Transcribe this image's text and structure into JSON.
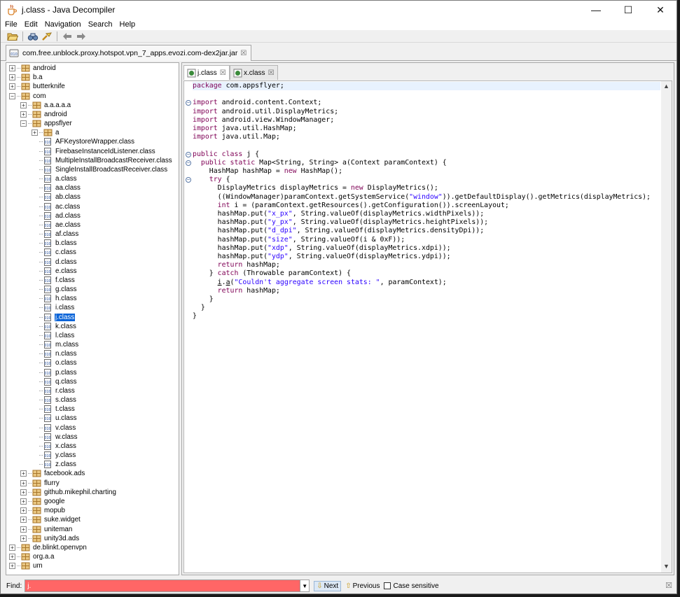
{
  "window": {
    "title": "j.class - Java Decompiler",
    "minimize": "—",
    "maximize": "☐",
    "close": "✕"
  },
  "menu": [
    "File",
    "Edit",
    "Navigation",
    "Search",
    "Help"
  ],
  "file_tab": {
    "label": "com.free.unblock.proxy.hotspot.vpn_7_apps.evozi.com-dex2jar.jar",
    "close": "☒"
  },
  "tree": [
    {
      "label": "android",
      "kind": "pkg",
      "level": 0,
      "expanded": false
    },
    {
      "label": "b.a",
      "kind": "pkg",
      "level": 0,
      "expanded": false
    },
    {
      "label": "butterknife",
      "kind": "pkg",
      "level": 0,
      "expanded": false
    },
    {
      "label": "com",
      "kind": "pkg",
      "level": 0,
      "expanded": true
    },
    {
      "label": "a.a.a.a.a",
      "kind": "pkg",
      "level": 1,
      "expanded": false
    },
    {
      "label": "android",
      "kind": "pkg",
      "level": 1,
      "expanded": false
    },
    {
      "label": "appsflyer",
      "kind": "pkg",
      "level": 1,
      "expanded": true
    },
    {
      "label": "a",
      "kind": "pkg",
      "level": 2,
      "expanded": false
    },
    {
      "label": "AFKeystoreWrapper.class",
      "kind": "class",
      "level": 2
    },
    {
      "label": "FirebaseInstanceIdListener.class",
      "kind": "class",
      "level": 2
    },
    {
      "label": "MultipleInstallBroadcastReceiver.class",
      "kind": "class",
      "level": 2
    },
    {
      "label": "SingleInstallBroadcastReceiver.class",
      "kind": "class",
      "level": 2
    },
    {
      "label": "a.class",
      "kind": "class",
      "level": 2
    },
    {
      "label": "aa.class",
      "kind": "class",
      "level": 2
    },
    {
      "label": "ab.class",
      "kind": "class",
      "level": 2
    },
    {
      "label": "ac.class",
      "kind": "class",
      "level": 2
    },
    {
      "label": "ad.class",
      "kind": "class",
      "level": 2
    },
    {
      "label": "ae.class",
      "kind": "class",
      "level": 2
    },
    {
      "label": "af.class",
      "kind": "class",
      "level": 2
    },
    {
      "label": "b.class",
      "kind": "class",
      "level": 2
    },
    {
      "label": "c.class",
      "kind": "class",
      "level": 2
    },
    {
      "label": "d.class",
      "kind": "class",
      "level": 2
    },
    {
      "label": "e.class",
      "kind": "class",
      "level": 2
    },
    {
      "label": "f.class",
      "kind": "class",
      "level": 2
    },
    {
      "label": "g.class",
      "kind": "class",
      "level": 2
    },
    {
      "label": "h.class",
      "kind": "class",
      "level": 2
    },
    {
      "label": "i.class",
      "kind": "class",
      "level": 2
    },
    {
      "label": "j.class",
      "kind": "class",
      "level": 2,
      "selected": true
    },
    {
      "label": "k.class",
      "kind": "class",
      "level": 2
    },
    {
      "label": "l.class",
      "kind": "class",
      "level": 2
    },
    {
      "label": "m.class",
      "kind": "class",
      "level": 2
    },
    {
      "label": "n.class",
      "kind": "class",
      "level": 2
    },
    {
      "label": "o.class",
      "kind": "class",
      "level": 2
    },
    {
      "label": "p.class",
      "kind": "class",
      "level": 2
    },
    {
      "label": "q.class",
      "kind": "class",
      "level": 2
    },
    {
      "label": "r.class",
      "kind": "class",
      "level": 2
    },
    {
      "label": "s.class",
      "kind": "class",
      "level": 2
    },
    {
      "label": "t.class",
      "kind": "class",
      "level": 2
    },
    {
      "label": "u.class",
      "kind": "class",
      "level": 2
    },
    {
      "label": "v.class",
      "kind": "class",
      "level": 2
    },
    {
      "label": "w.class",
      "kind": "class",
      "level": 2
    },
    {
      "label": "x.class",
      "kind": "class",
      "level": 2
    },
    {
      "label": "y.class",
      "kind": "class",
      "level": 2
    },
    {
      "label": "z.class",
      "kind": "class",
      "level": 2
    },
    {
      "label": "facebook.ads",
      "kind": "pkg",
      "level": 1,
      "expanded": false
    },
    {
      "label": "flurry",
      "kind": "pkg",
      "level": 1,
      "expanded": false
    },
    {
      "label": "github.mikephil.charting",
      "kind": "pkg",
      "level": 1,
      "expanded": false
    },
    {
      "label": "google",
      "kind": "pkg",
      "level": 1,
      "expanded": false
    },
    {
      "label": "mopub",
      "kind": "pkg",
      "level": 1,
      "expanded": false
    },
    {
      "label": "suke.widget",
      "kind": "pkg",
      "level": 1,
      "expanded": false
    },
    {
      "label": "uniteman",
      "kind": "pkg",
      "level": 1,
      "expanded": false
    },
    {
      "label": "unity3d.ads",
      "kind": "pkg",
      "level": 1,
      "expanded": false
    },
    {
      "label": "de.blinkt.openvpn",
      "kind": "pkg",
      "level": 0,
      "expanded": false
    },
    {
      "label": "org.a.a",
      "kind": "pkg",
      "level": 0,
      "expanded": false
    },
    {
      "label": "um",
      "kind": "pkg",
      "level": 0,
      "expanded": false
    }
  ],
  "editor_tabs": [
    {
      "label": "j.class",
      "close": "☒",
      "active": true
    },
    {
      "label": "x.class",
      "close": "☒",
      "active": false
    }
  ],
  "code": [
    [
      [
        "k",
        "package"
      ],
      [
        "t",
        " com.appsflyer;"
      ]
    ],
    [],
    [
      [
        "k",
        "import"
      ],
      [
        "t",
        " android.content.Context;"
      ]
    ],
    [
      [
        "k",
        "import"
      ],
      [
        "t",
        " android.util.DisplayMetrics;"
      ]
    ],
    [
      [
        "k",
        "import"
      ],
      [
        "t",
        " android.view.WindowManager;"
      ]
    ],
    [
      [
        "k",
        "import"
      ],
      [
        "t",
        " java.util.HashMap;"
      ]
    ],
    [
      [
        "k",
        "import"
      ],
      [
        "t",
        " java.util.Map;"
      ]
    ],
    [],
    [
      [
        "k",
        "public class"
      ],
      [
        "t",
        " j {"
      ]
    ],
    [
      [
        "t",
        "  "
      ],
      [
        "k",
        "public static"
      ],
      [
        "t",
        " Map<String, String> a(Context paramContext) {"
      ]
    ],
    [
      [
        "t",
        "    HashMap hashMap = "
      ],
      [
        "k",
        "new"
      ],
      [
        "t",
        " HashMap();"
      ]
    ],
    [
      [
        "t",
        "    "
      ],
      [
        "k",
        "try"
      ],
      [
        "t",
        " {"
      ]
    ],
    [
      [
        "t",
        "      DisplayMetrics displayMetrics = "
      ],
      [
        "k",
        "new"
      ],
      [
        "t",
        " DisplayMetrics();"
      ]
    ],
    [
      [
        "t",
        "      ((WindowManager)paramContext.getSystemService("
      ],
      [
        "s",
        "\"window\""
      ],
      [
        "t",
        ")).getDefaultDisplay().getMetrics(displayMetrics);"
      ]
    ],
    [
      [
        "t",
        "      "
      ],
      [
        "k",
        "int"
      ],
      [
        "t",
        " i = (paramContext.getResources().getConfiguration()).screenLayout;"
      ]
    ],
    [
      [
        "t",
        "      hashMap.put("
      ],
      [
        "s",
        "\"x_px\""
      ],
      [
        "t",
        ", String.valueOf(displayMetrics.widthPixels));"
      ]
    ],
    [
      [
        "t",
        "      hashMap.put("
      ],
      [
        "s",
        "\"y_px\""
      ],
      [
        "t",
        ", String.valueOf(displayMetrics.heightPixels));"
      ]
    ],
    [
      [
        "t",
        "      hashMap.put("
      ],
      [
        "s",
        "\"d_dpi\""
      ],
      [
        "t",
        ", String.valueOf(displayMetrics.densityDpi));"
      ]
    ],
    [
      [
        "t",
        "      hashMap.put("
      ],
      [
        "s",
        "\"size\""
      ],
      [
        "t",
        ", String.valueOf(i & 0xF));"
      ]
    ],
    [
      [
        "t",
        "      hashMap.put("
      ],
      [
        "s",
        "\"xdp\""
      ],
      [
        "t",
        ", String.valueOf(displayMetrics.xdpi));"
      ]
    ],
    [
      [
        "t",
        "      hashMap.put("
      ],
      [
        "s",
        "\"ydp\""
      ],
      [
        "t",
        ", String.valueOf(displayMetrics.ydpi));"
      ]
    ],
    [
      [
        "t",
        "      "
      ],
      [
        "k",
        "return"
      ],
      [
        "t",
        " hashMap;"
      ]
    ],
    [
      [
        "t",
        "    } "
      ],
      [
        "k",
        "catch"
      ],
      [
        "t",
        " (Throwable paramContext) {"
      ]
    ],
    [
      [
        "t",
        "      "
      ],
      [
        "u",
        "i"
      ],
      [
        "t",
        "."
      ],
      [
        "u",
        "a"
      ],
      [
        "t",
        "("
      ],
      [
        "s",
        "\"Couldn't aggregate screen stats: \""
      ],
      [
        "t",
        ", paramContext);"
      ]
    ],
    [
      [
        "t",
        "      "
      ],
      [
        "k",
        "return"
      ],
      [
        "t",
        " hashMap;"
      ]
    ],
    [
      [
        "t",
        "    }"
      ]
    ],
    [
      [
        "t",
        "  }"
      ]
    ],
    [
      [
        "t",
        "}"
      ]
    ]
  ],
  "folds": [
    {
      "line": 2,
      "sym": "−"
    },
    {
      "line": 8,
      "sym": "−"
    },
    {
      "line": 9,
      "sym": "−"
    },
    {
      "line": 11,
      "sym": "−"
    }
  ],
  "findbar": {
    "label": "Find:",
    "value": "j.",
    "next": "Next",
    "previous": "Previous",
    "case_sensitive": "Case sensitive",
    "close": "☒"
  },
  "colors": {
    "keyword": "#7f0055",
    "string": "#2a00ff",
    "find_error_bg": "#ff6666",
    "selection": "#0a64d8"
  }
}
